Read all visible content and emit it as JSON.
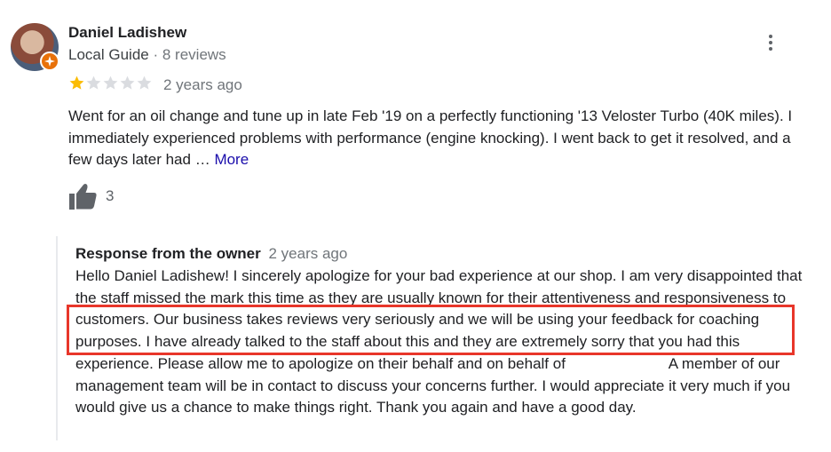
{
  "review": {
    "reviewer_name": "Daniel Ladishew",
    "reviewer_role": "Local Guide",
    "separator": "·",
    "reviewer_review_count": "8 reviews",
    "rating": 1,
    "rating_max": 5,
    "date": "2 years ago",
    "text": "Went for an oil change and tune up in late Feb '19 on a perfectly functioning '13 Veloster Turbo (40K miles).  I immediately experienced problems with performance (engine knocking).  I went back to get it resolved, and a few days later had …",
    "more_label": "More",
    "like_count": "3"
  },
  "owner_response": {
    "heading": "Response from the owner",
    "date": "2 years ago",
    "text_part1": "Hello Daniel Ladishew! I sincerely apologize for your bad experience at our shop. I am very disappointed that the staff missed the mark this time as they are usually known for their attentiveness and responsiveness to customers. Our business takes reviews very seriously and we will be using your feedback for coaching purposes. I have already talked to the staff about this and they are extremely sorry that you had this experience. Please allow me to apologize on their behalf and on behalf of",
    "text_part2": "A member of our management team will be in contact to discuss your concerns further. I would appreciate it very much if you would give us a chance to make things right. Thank you again and have a good day."
  },
  "colors": {
    "star_filled": "#fbbc04",
    "star_empty": "#dadce0",
    "highlight": "#e8362a",
    "link": "#1a0dab",
    "local_guide_badge": "#e8710a"
  },
  "icons": {
    "more": "more-vert-icon",
    "like": "thumb-up-icon",
    "badge": "local-guide-badge-icon"
  }
}
